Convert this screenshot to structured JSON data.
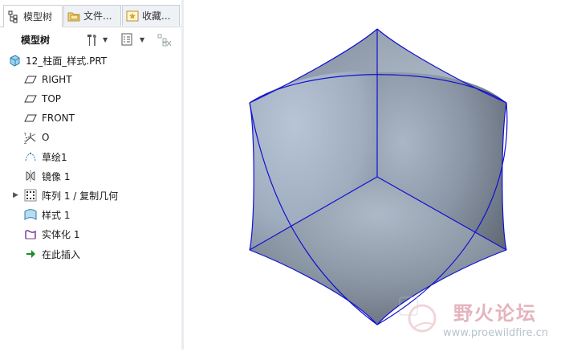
{
  "tabs": [
    {
      "label": "模型树",
      "icon": "model-tree-icon",
      "active": true
    },
    {
      "label": "文件...",
      "icon": "folder-icon",
      "active": false
    },
    {
      "label": "收藏...",
      "icon": "favorites-icon",
      "active": false
    }
  ],
  "toolbar": {
    "title": "模型树",
    "settings_icon": "tools-icon",
    "show_icon": "list-icon",
    "filter_icon": "filter-icon"
  },
  "tree": {
    "root": {
      "label": "12_柱面_样式.PRT",
      "icon": "part-icon"
    },
    "items": [
      {
        "label": "RIGHT",
        "icon": "datum-plane-icon",
        "expandable": false
      },
      {
        "label": "TOP",
        "icon": "datum-plane-icon",
        "expandable": false
      },
      {
        "label": "FRONT",
        "icon": "datum-plane-icon",
        "expandable": false
      },
      {
        "label": "O",
        "icon": "coordinate-system-icon",
        "expandable": false
      },
      {
        "label": "草绘1",
        "icon": "sketch-icon",
        "expandable": false
      },
      {
        "label": "镜像 1",
        "icon": "mirror-icon",
        "expandable": false
      },
      {
        "label": "阵列 1 / 复制几何",
        "icon": "pattern-icon",
        "expandable": true
      },
      {
        "label": "样式 1",
        "icon": "style-icon",
        "expandable": false
      },
      {
        "label": "实体化 1",
        "icon": "solidify-icon",
        "expandable": false
      },
      {
        "label": "在此插入",
        "icon": "insert-here-arrow-icon",
        "expandable": false
      }
    ]
  },
  "watermark": {
    "text": "野火论坛",
    "url": "www.proewildfire.cn"
  },
  "colors": {
    "edge": "#1010d0",
    "panel_border": "#c9cdd3",
    "watermark": "#e0a7b3"
  }
}
